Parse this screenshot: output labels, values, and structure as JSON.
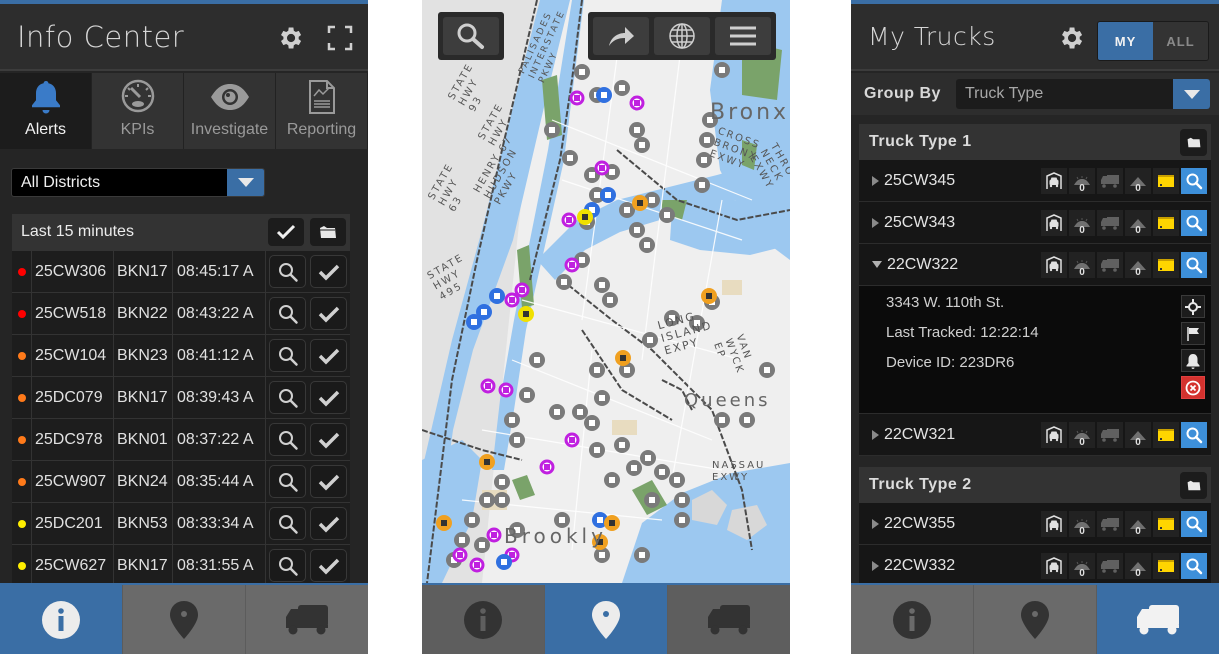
{
  "colors": {
    "accent": "#3a6ea5",
    "panel_bg": "#252525",
    "alert_red": "#ff0000",
    "alert_orange": "#ff7a1a",
    "alert_yellow": "#ffee00",
    "search_blue": "#3d8fd9",
    "map_water": "#9cc8f0",
    "map_park": "#7aa36a",
    "marker_gray": "#7a7a7a",
    "marker_magenta": "#c020e0",
    "marker_blue": "#3070e0",
    "marker_orange": "#f0a020",
    "marker_yellow": "#f0e000"
  },
  "info_center": {
    "title": "Info Center",
    "header_icons": [
      "gear-icon",
      "fullscreen-icon"
    ],
    "tabs": [
      {
        "label": "Alerts",
        "icon": "bell-icon",
        "active": true
      },
      {
        "label": "KPIs",
        "icon": "gauge-icon",
        "active": false
      },
      {
        "label": "Investigate",
        "icon": "eye-icon",
        "active": false
      },
      {
        "label": "Reporting",
        "icon": "report-icon",
        "active": false
      }
    ],
    "district_select": {
      "value": "All Districts"
    },
    "alerts_header": "Last 15 minutes",
    "alerts": [
      {
        "severity": "red",
        "truck": "25CW306",
        "district": "BKN17",
        "time": "08:45:17 A"
      },
      {
        "severity": "red",
        "truck": "25CW518",
        "district": "BKN22",
        "time": "08:43:22 A"
      },
      {
        "severity": "orange",
        "truck": "25CW104",
        "district": "BKN23",
        "time": "08:41:12 A"
      },
      {
        "severity": "orange",
        "truck": "25DC079",
        "district": "BKN17",
        "time": "08:39:43 A"
      },
      {
        "severity": "orange",
        "truck": "25DC978",
        "district": "BKN01",
        "time": "08:37:22 A"
      },
      {
        "severity": "orange",
        "truck": "25CW907",
        "district": "BKN24",
        "time": "08:35:44 A"
      },
      {
        "severity": "yellow",
        "truck": "25DC201",
        "district": "BKN53",
        "time": "08:33:34 A"
      },
      {
        "severity": "yellow",
        "truck": "25CW627",
        "district": "BKN17",
        "time": "08:31:55 A"
      }
    ]
  },
  "map_view": {
    "toolbar": [
      "search-icon",
      "share-icon",
      "globe-icon",
      "menu-icon"
    ],
    "labels": {
      "bronx": "Bronx",
      "queens": "Queens",
      "brooklyn": "Brookly",
      "cross_bronx": "CROSS BRONX EXWY",
      "throgs": "THROGS NECK EXWY",
      "lie": "LONG ISLAND EXPY",
      "van_wyck": "VAN WYCK EP",
      "nassau": "NASSAU EXWY",
      "hudson": "HENRY HUDSON PKWY",
      "palisades": "PALISADES INTERSTATE PKWY",
      "hwy93": "STATE HWY 93",
      "hwy67": "STATE HWY 67",
      "hwy63": "STATE HWY 63",
      "hwy495": "STATE HWY 495"
    }
  },
  "my_trucks": {
    "title": "My Trucks",
    "toggle": {
      "my": "MY",
      "all": "ALL",
      "selected": "MY"
    },
    "group_by_label": "Group By",
    "group_by_value": "Truck Type",
    "groups": [
      {
        "name": "Truck Type 1",
        "trucks": [
          {
            "id": "25CW345",
            "expanded": false,
            "count_a": "0",
            "count_b": "0"
          },
          {
            "id": "25CW343",
            "expanded": false,
            "count_a": "0",
            "count_b": "0"
          },
          {
            "id": "22CW322",
            "expanded": true,
            "count_a": "0",
            "count_b": "0",
            "details": {
              "address": "3343 W. 110th St.",
              "last_tracked": "Last Tracked: 12:22:14",
              "device": "Device ID: 223DR6"
            }
          },
          {
            "id": "22CW321",
            "expanded": false,
            "count_a": "0",
            "count_b": "0"
          }
        ]
      },
      {
        "name": "Truck Type 2",
        "trucks": [
          {
            "id": "22CW355",
            "expanded": false,
            "count_a": "0",
            "count_b": "0"
          },
          {
            "id": "22CW332",
            "expanded": false,
            "count_a": "0",
            "count_b": "0"
          }
        ]
      }
    ]
  },
  "bottom_nav": {
    "items": [
      "info-icon",
      "map-pin-icon",
      "truck-icon"
    ],
    "left_active": "info",
    "map_active": "map",
    "right_active": "trucks"
  }
}
